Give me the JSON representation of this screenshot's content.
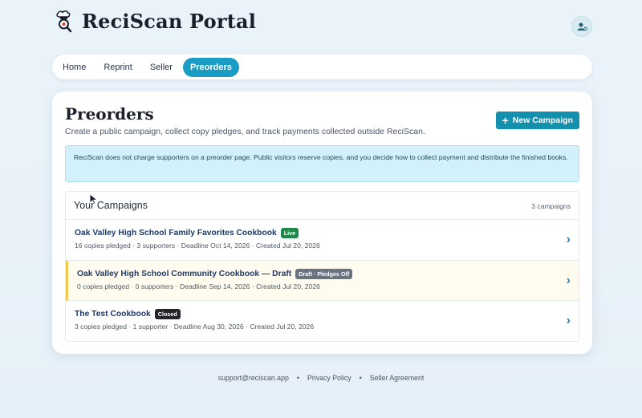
{
  "app": {
    "title": "ReciScan Portal"
  },
  "nav": {
    "items": [
      {
        "label": "Home",
        "active": false
      },
      {
        "label": "Reprint",
        "active": false
      },
      {
        "label": "Seller",
        "active": false
      },
      {
        "label": "Preorders",
        "active": true
      }
    ]
  },
  "page": {
    "title": "Preorders",
    "subtitle": "Create a public campaign, collect copy pledges, and track payments collected outside ReciScan.",
    "new_button": "New Campaign",
    "info": "ReciScan does not charge supporters on a preorder page. Public visitors reserve copies, and you decide how to collect payment and distribute the finished books."
  },
  "campaigns": {
    "title": "Your Campaigns",
    "count": "3 campaigns",
    "rows": [
      {
        "name": "Oak Valley High School Family Favorites Cookbook",
        "badge": "Live",
        "meta": "16 copies pledged · 3 supporters · Deadline Oct 14, 2026 · Created Jul 20, 2026"
      },
      {
        "name": "Oak Valley High School Community Cookbook — Draft",
        "badge": "Draft · Pledges Off",
        "meta": "0 copies pledged · 0 supporters · Deadline Sep 14, 2026 · Created Jul 20, 2026"
      },
      {
        "name": "The Test Cookbook",
        "badge": "Closed",
        "meta": "3 copies pledged · 1 supporter · Deadline Aug 30, 2026 · Created Jul 20, 2026"
      }
    ]
  },
  "footer": {
    "email": "support@reciscan.app",
    "sep": "•",
    "privacy": "Privacy Policy",
    "agreement": "Seller Agreement"
  },
  "colors": {
    "accent": "#1a9dc4",
    "button": "#1390ad",
    "live": "#1e8a4a",
    "closed": "#23262b",
    "info_bg": "#d3f1fa"
  }
}
